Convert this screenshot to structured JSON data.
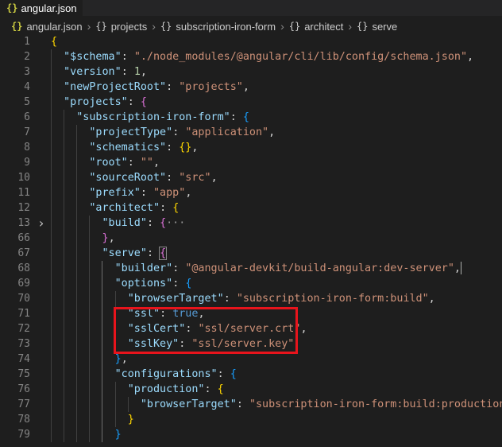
{
  "tab": {
    "icon": "json-braces-icon",
    "label": "angular.json"
  },
  "breadcrumbs": [
    {
      "icon": "{}",
      "label": "angular.json",
      "file": true
    },
    {
      "icon": "{}",
      "label": "projects"
    },
    {
      "icon": "{}",
      "label": "subscription-iron-form"
    },
    {
      "icon": "{}",
      "label": "architect"
    },
    {
      "icon": "{}",
      "label": "serve"
    }
  ],
  "lines": [
    {
      "n": "1",
      "indent": 0,
      "tokens": [
        [
          "br1",
          "{"
        ]
      ]
    },
    {
      "n": "2",
      "indent": 2,
      "tokens": [
        [
          "k",
          "\"$schema\""
        ],
        [
          "p",
          ": "
        ],
        [
          "s",
          "\"./node_modules/@angular/cli/lib/config/schema.json\""
        ],
        [
          "p",
          ","
        ]
      ]
    },
    {
      "n": "3",
      "indent": 2,
      "tokens": [
        [
          "k",
          "\"version\""
        ],
        [
          "p",
          ": "
        ],
        [
          "n",
          "1"
        ],
        [
          "p",
          ","
        ]
      ]
    },
    {
      "n": "4",
      "indent": 2,
      "tokens": [
        [
          "k",
          "\"newProjectRoot\""
        ],
        [
          "p",
          ": "
        ],
        [
          "s",
          "\"projects\""
        ],
        [
          "p",
          ","
        ]
      ]
    },
    {
      "n": "5",
      "indent": 2,
      "tokens": [
        [
          "k",
          "\"projects\""
        ],
        [
          "p",
          ": "
        ],
        [
          "br2",
          "{"
        ]
      ]
    },
    {
      "n": "6",
      "indent": 4,
      "tokens": [
        [
          "k",
          "\"subscription-iron-form\""
        ],
        [
          "p",
          ": "
        ],
        [
          "br3",
          "{"
        ]
      ]
    },
    {
      "n": "7",
      "indent": 6,
      "tokens": [
        [
          "k",
          "\"projectType\""
        ],
        [
          "p",
          ": "
        ],
        [
          "s",
          "\"application\""
        ],
        [
          "p",
          ","
        ]
      ]
    },
    {
      "n": "8",
      "indent": 6,
      "tokens": [
        [
          "k",
          "\"schematics\""
        ],
        [
          "p",
          ": "
        ],
        [
          "br1",
          "{}"
        ],
        [
          "p",
          ","
        ]
      ]
    },
    {
      "n": "9",
      "indent": 6,
      "tokens": [
        [
          "k",
          "\"root\""
        ],
        [
          "p",
          ": "
        ],
        [
          "s",
          "\"\""
        ],
        [
          "p",
          ","
        ]
      ]
    },
    {
      "n": "10",
      "indent": 6,
      "tokens": [
        [
          "k",
          "\"sourceRoot\""
        ],
        [
          "p",
          ": "
        ],
        [
          "s",
          "\"src\""
        ],
        [
          "p",
          ","
        ]
      ]
    },
    {
      "n": "11",
      "indent": 6,
      "tokens": [
        [
          "k",
          "\"prefix\""
        ],
        [
          "p",
          ": "
        ],
        [
          "s",
          "\"app\""
        ],
        [
          "p",
          ","
        ]
      ]
    },
    {
      "n": "12",
      "indent": 6,
      "tokens": [
        [
          "k",
          "\"architect\""
        ],
        [
          "p",
          ": "
        ],
        [
          "br1",
          "{"
        ]
      ]
    },
    {
      "n": "13",
      "indent": 8,
      "fold": true,
      "tokens": [
        [
          "k",
          "\"build\""
        ],
        [
          "p",
          ": "
        ],
        [
          "br2",
          "{"
        ],
        [
          "ell",
          "···"
        ]
      ]
    },
    {
      "n": "66",
      "indent": 8,
      "tokens": [
        [
          "br2",
          "}"
        ],
        [
          "p",
          ","
        ]
      ]
    },
    {
      "n": "67",
      "indent": 8,
      "tokens": [
        [
          "k",
          "\"serve\""
        ],
        [
          "p",
          ": "
        ],
        [
          "br2",
          "{"
        ]
      ]
    },
    {
      "n": "68",
      "indent": 10,
      "tokens": [
        [
          "k",
          "\"builder\""
        ],
        [
          "p",
          ": "
        ],
        [
          "s",
          "\"@angular-devkit/build-angular:dev-server\""
        ],
        [
          "p",
          ","
        ]
      ]
    },
    {
      "n": "69",
      "indent": 10,
      "tokens": [
        [
          "k",
          "\"options\""
        ],
        [
          "p",
          ": "
        ],
        [
          "br3",
          "{"
        ]
      ]
    },
    {
      "n": "70",
      "indent": 12,
      "tokens": [
        [
          "k",
          "\"browserTarget\""
        ],
        [
          "p",
          ": "
        ],
        [
          "s",
          "\"subscription-iron-form:build\""
        ],
        [
          "p",
          ","
        ]
      ]
    },
    {
      "n": "71",
      "indent": 12,
      "tokens": [
        [
          "k",
          "\"ssl\""
        ],
        [
          "p",
          ": "
        ],
        [
          "b",
          "true"
        ],
        [
          "p",
          ","
        ]
      ]
    },
    {
      "n": "72",
      "indent": 12,
      "tokens": [
        [
          "k",
          "\"sslCert\""
        ],
        [
          "p",
          ": "
        ],
        [
          "s",
          "\"ssl/server.crt\""
        ],
        [
          "p",
          ","
        ]
      ]
    },
    {
      "n": "73",
      "indent": 12,
      "tokens": [
        [
          "k",
          "\"sslKey\""
        ],
        [
          "p",
          ": "
        ],
        [
          "s",
          "\"ssl/server.key\""
        ]
      ]
    },
    {
      "n": "74",
      "indent": 10,
      "tokens": [
        [
          "br3",
          "}"
        ],
        [
          "p",
          ","
        ]
      ]
    },
    {
      "n": "75",
      "indent": 10,
      "tokens": [
        [
          "k",
          "\"configurations\""
        ],
        [
          "p",
          ": "
        ],
        [
          "br3",
          "{"
        ]
      ]
    },
    {
      "n": "76",
      "indent": 12,
      "tokens": [
        [
          "k",
          "\"production\""
        ],
        [
          "p",
          ": "
        ],
        [
          "br1",
          "{"
        ]
      ]
    },
    {
      "n": "77",
      "indent": 14,
      "tokens": [
        [
          "k",
          "\"browserTarget\""
        ],
        [
          "p",
          ": "
        ],
        [
          "s",
          "\"subscription-iron-form:build:production\""
        ]
      ]
    },
    {
      "n": "78",
      "indent": 12,
      "tokens": [
        [
          "br1",
          "}"
        ]
      ]
    },
    {
      "n": "79",
      "indent": 10,
      "tokens": [
        [
          "br3",
          "}"
        ]
      ]
    }
  ],
  "colors": {
    "key": "#9cdcfe",
    "string": "#ce9178",
    "number": "#b5cea8",
    "boolean": "#569cd6",
    "highlight_box": "#e8141c"
  }
}
